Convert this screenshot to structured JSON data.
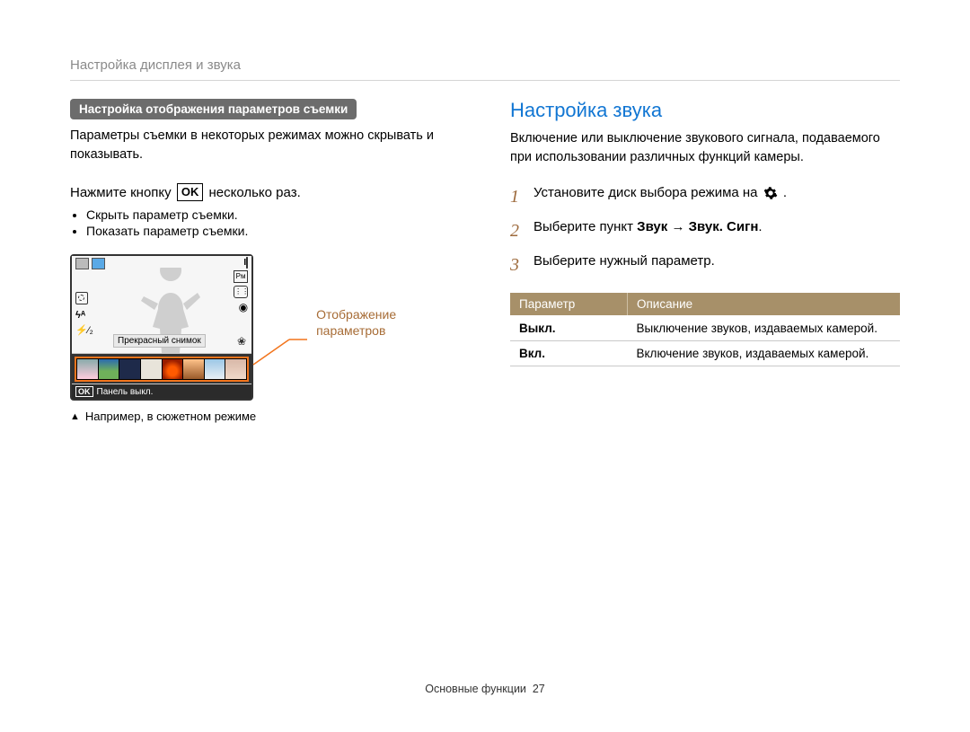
{
  "breadcrumb": "Настройка дисплея и звука",
  "left": {
    "pill": "Настройка отображения параметров съемки",
    "intro": "Параметры съемки в некоторых режимах можно скрывать и показывать.",
    "instruction_before": "Нажмите кнопку",
    "instruction_ok": "OK",
    "instruction_after": "несколько раз.",
    "bullets": [
      "Скрыть параметр съемки.",
      "Показать параметр съемки."
    ],
    "screen": {
      "tooltip": "Прекрасный снимок",
      "bottom_ok": "OK",
      "bottom_label": "Панель выкл."
    },
    "callout": "Отображение параметров",
    "caption": "Например, в сюжетном режиме"
  },
  "right": {
    "heading": "Настройка звука",
    "intro": "Включение или выключение звукового сигнала, подаваемого при использовании различных функций камеры.",
    "steps": [
      {
        "n": "1",
        "html_parts": [
          "Установите диск выбора режима на ",
          " ."
        ],
        "has_gear": true,
        "bold": ""
      },
      {
        "n": "2",
        "prefix": "Выберите пункт ",
        "bold": "Звук",
        "arrow": " → ",
        "bold2": "Звук. Сигн",
        "suffix": "."
      },
      {
        "n": "3",
        "text": "Выберите нужный параметр."
      }
    ],
    "table": {
      "head_param": "Параметр",
      "head_desc": "Описание",
      "rows": [
        {
          "p": "Выкл.",
          "d": "Выключение звуков, издаваемых камерой."
        },
        {
          "p": "Вкл.",
          "d": "Включение звуков, издаваемых камерой."
        }
      ]
    }
  },
  "footer": {
    "section": "Основные функции",
    "page": "27"
  }
}
